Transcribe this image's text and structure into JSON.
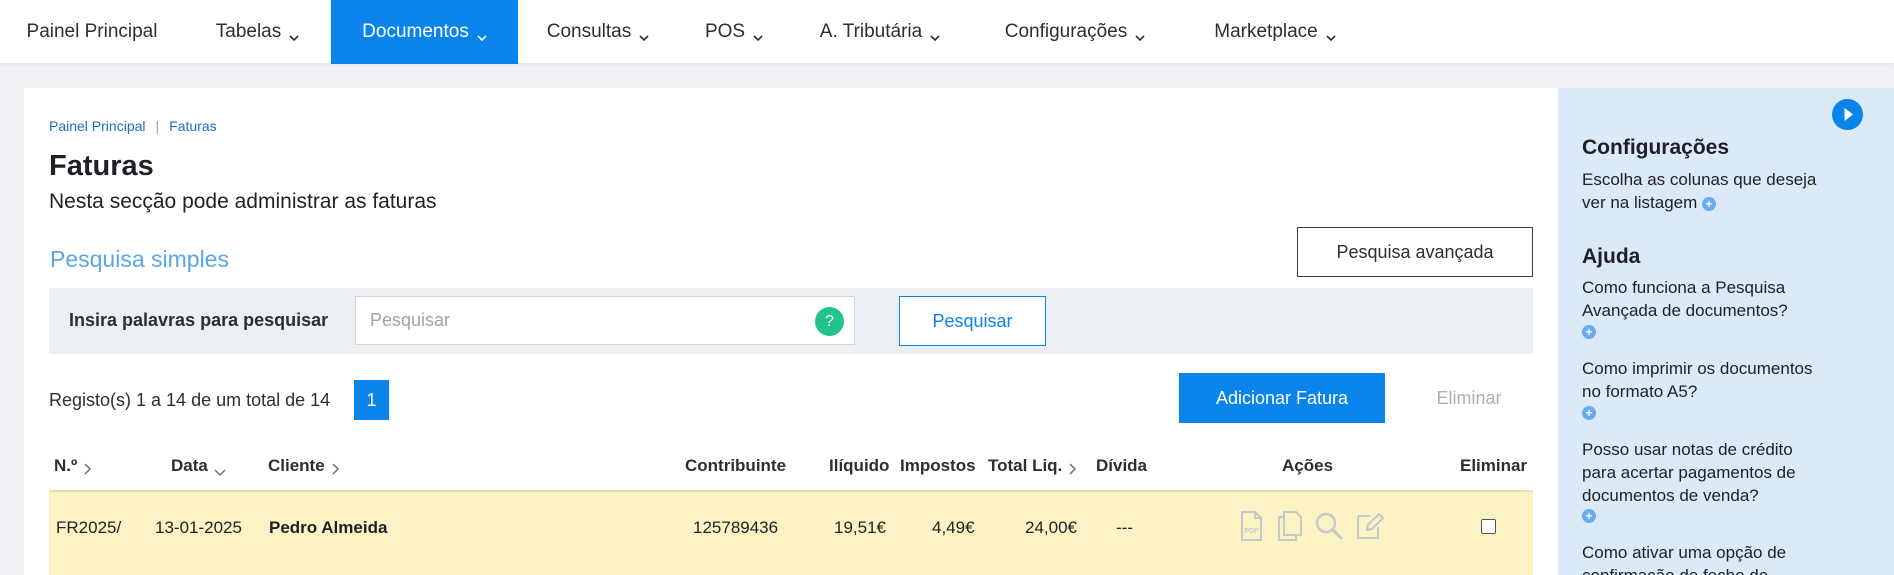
{
  "nav": {
    "items": [
      {
        "label": "Painel Principal",
        "dropdown": false
      },
      {
        "label": "Tabelas",
        "dropdown": true
      },
      {
        "label": "Documentos",
        "dropdown": true,
        "active": true
      },
      {
        "label": "Consultas",
        "dropdown": true
      },
      {
        "label": "POS",
        "dropdown": true
      },
      {
        "label": "A. Tributária",
        "dropdown": true
      },
      {
        "label": "Configurações",
        "dropdown": true
      },
      {
        "label": "Marketplace",
        "dropdown": true
      }
    ]
  },
  "breadcrumb": [
    "Painel Principal",
    "Faturas"
  ],
  "page": {
    "title": "Faturas",
    "subtitle": "Nesta secção pode administrar as faturas"
  },
  "search": {
    "section_title": "Pesquisa simples",
    "advanced_label": "Pesquisa avançada",
    "input_label": "Insira palavras para pesquisar",
    "placeholder": "Pesquisar",
    "value": "",
    "help_glyph": "?",
    "button_label": "Pesquisar"
  },
  "listing": {
    "records_text": "Registo(s) 1 a 14 de um total de 14",
    "current_page": "1",
    "add_label": "Adicionar Fatura",
    "delete_label": "Eliminar"
  },
  "table": {
    "headers": {
      "numero": "N.º",
      "data": "Data",
      "cliente": "Cliente",
      "contribuinte": "Contribuinte",
      "iliquido": "Ilíquido",
      "impostos": "Impostos",
      "total": "Total Liq.",
      "divida": "Dívida",
      "acoes": "Ações",
      "eliminar": "Eliminar"
    },
    "rows": [
      {
        "numero": "FR2025/",
        "data": "13-01-2025",
        "cliente": "Pedro Almeida",
        "contribuinte": "125789436",
        "iliquido": "19,51€",
        "impostos": "4,49€",
        "total": "24,00€",
        "divida": "---",
        "actions": [
          "pdf-icon",
          "copy-icon",
          "search-icon",
          "edit-icon"
        ],
        "checked": false
      }
    ]
  },
  "sidebar": {
    "config_title": "Configurações",
    "config_text": "Escolha as colunas que deseja ver na listagem",
    "help_title": "Ajuda",
    "help_items": [
      "Como funciona a Pesquisa Avançada de documentos?",
      "Como imprimir os documentos no formato A5?",
      "Posso usar notas de crédito para acertar pagamentos de documentos de venda?",
      "Como ativar uma opção de confirmação de fecho de"
    ],
    "plus_glyph": "+"
  },
  "colors": {
    "accent": "#0a84ea",
    "row_highlight": "#fbf3c4",
    "sidebar_bg": "#dce9f7",
    "help_green": "#22c38e"
  }
}
